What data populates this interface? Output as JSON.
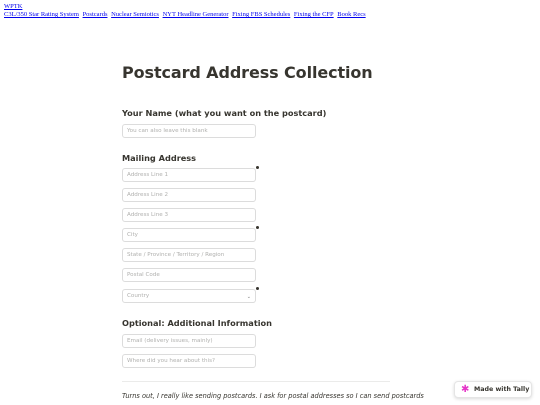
{
  "nav": {
    "home": "WPTK",
    "links": [
      "C3L/350 Star Rating System",
      "Postcards",
      "Nuclear Semiotics",
      "NYT Headline Generator",
      "Fixing FBS Schedules",
      "Fixing the CFP",
      "Book Recs"
    ]
  },
  "form": {
    "title": "Postcard Address Collection",
    "name_section": {
      "heading": "Your Name (what you want on the postcard)",
      "placeholder": "You can also leave this blank"
    },
    "mailing_section": {
      "heading": "Mailing Address",
      "fields": [
        "Address Line 1",
        "Address Line 2",
        "Address Line 3",
        "City",
        "State / Province / Territory / Region",
        "Postal Code"
      ],
      "country_placeholder": "Country",
      "required_marker": "*"
    },
    "optional_section": {
      "heading": "Optional: Additional Information",
      "email_placeholder": "Email (delivery issues, mainly)",
      "source_placeholder": "Where did you hear about this?"
    },
    "intro_text": "Turns out, I really like sending postcards. I ask for postal addresses so I can send postcards"
  },
  "badge": {
    "label": "Made with Tally",
    "icon": "tally-star-icon",
    "color": "#e536c8"
  }
}
